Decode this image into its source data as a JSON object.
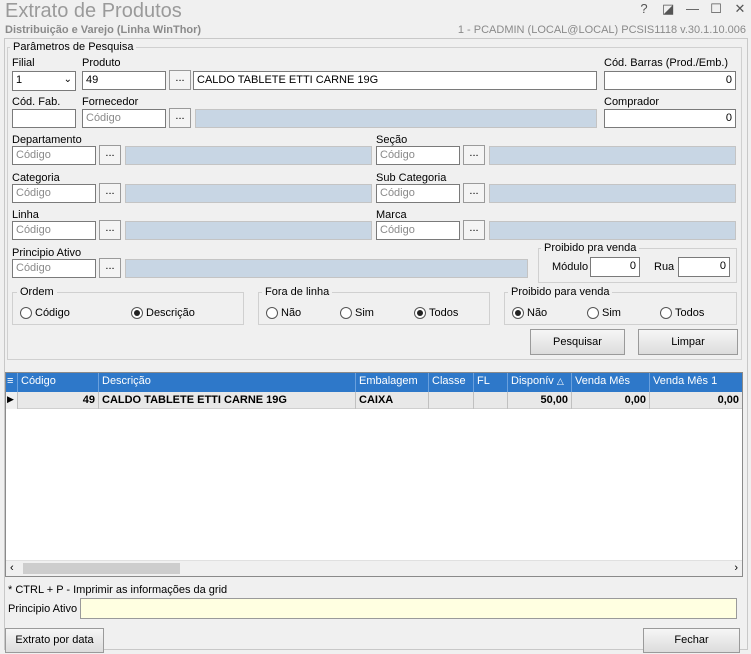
{
  "window": {
    "title": "Extrato de Produtos",
    "subtitle": "Distribuição e Varejo (Linha WinThor)",
    "user_info": "1 - PCADMIN (LOCAL@LOCAL)   PCSIS1118  v.30.1.10.006",
    "controls": [
      "?",
      "◪",
      "—",
      "☐",
      "✕"
    ]
  },
  "params": {
    "group_title": "Parâmetros de Pesquisa",
    "filial": {
      "label": "Filial",
      "value": "1"
    },
    "produto": {
      "label": "Produto",
      "code": "49",
      "description": "CALDO TABLETE ETTI CARNE 19G"
    },
    "cod_barras": {
      "label": "Cód. Barras (Prod./Emb.)",
      "value": "0"
    },
    "cod_fab": {
      "label": "Cód. Fab.",
      "value": ""
    },
    "fornecedor": {
      "label": "Fornecedor",
      "placeholder": "Código"
    },
    "comprador": {
      "label": "Comprador",
      "value": "0"
    },
    "departamento": {
      "label": "Departamento",
      "placeholder": "Código"
    },
    "secao": {
      "label": "Seção",
      "placeholder": "Código"
    },
    "categoria": {
      "label": "Categoria",
      "placeholder": "Código"
    },
    "sub_categoria": {
      "label": "Sub Categoria",
      "placeholder": "Código"
    },
    "linha": {
      "label": "Linha",
      "placeholder": "Código"
    },
    "marca": {
      "label": "Marca",
      "placeholder": "Código"
    },
    "principio_ativo": {
      "label": "Principio Ativo",
      "placeholder": "Código"
    },
    "dots": "...",
    "proibido_venda_box": {
      "title": "Proibido pra venda",
      "modulo_label": "Módulo",
      "modulo_value": "0",
      "rua_label": "Rua",
      "rua_value": "0"
    },
    "ordem": {
      "title": "Ordem",
      "options": [
        "Código",
        "Descrição"
      ],
      "selected": 1
    },
    "fora_linha": {
      "title": "Fora de linha",
      "options": [
        "Não",
        "Sim",
        "Todos"
      ],
      "selected": 2
    },
    "proibido_para_venda": {
      "title": "Proibido para venda",
      "options": [
        "Não",
        "Sim",
        "Todos"
      ],
      "selected": 0
    },
    "pesquisar_label": "Pesquisar",
    "limpar_label": "Limpar"
  },
  "grid": {
    "columns": [
      "Código",
      "Descrição",
      "Embalagem",
      "Classe",
      "FL",
      "Disponív",
      "Venda Mês",
      "Venda Mês 1"
    ],
    "rows": [
      {
        "codigo": "49",
        "descricao": "CALDO TABLETE ETTI CARNE 19G",
        "embalagem": "CAIXA",
        "classe": "",
        "fl": "",
        "disponivel": "50,00",
        "venda_mes": "0,00",
        "venda_mes_1": "0,00"
      }
    ]
  },
  "footer": {
    "hint": "* CTRL + P - Imprimir as informações da grid",
    "principio_label": "Principio Ativo",
    "principio_value": "",
    "extrato_label": "Extrato por data",
    "fechar_label": "Fechar"
  },
  "colors": {
    "header_blue": "#2e78c9",
    "readonly_blue": "#c8d6e4",
    "yellow_field": "#ffffe1"
  }
}
